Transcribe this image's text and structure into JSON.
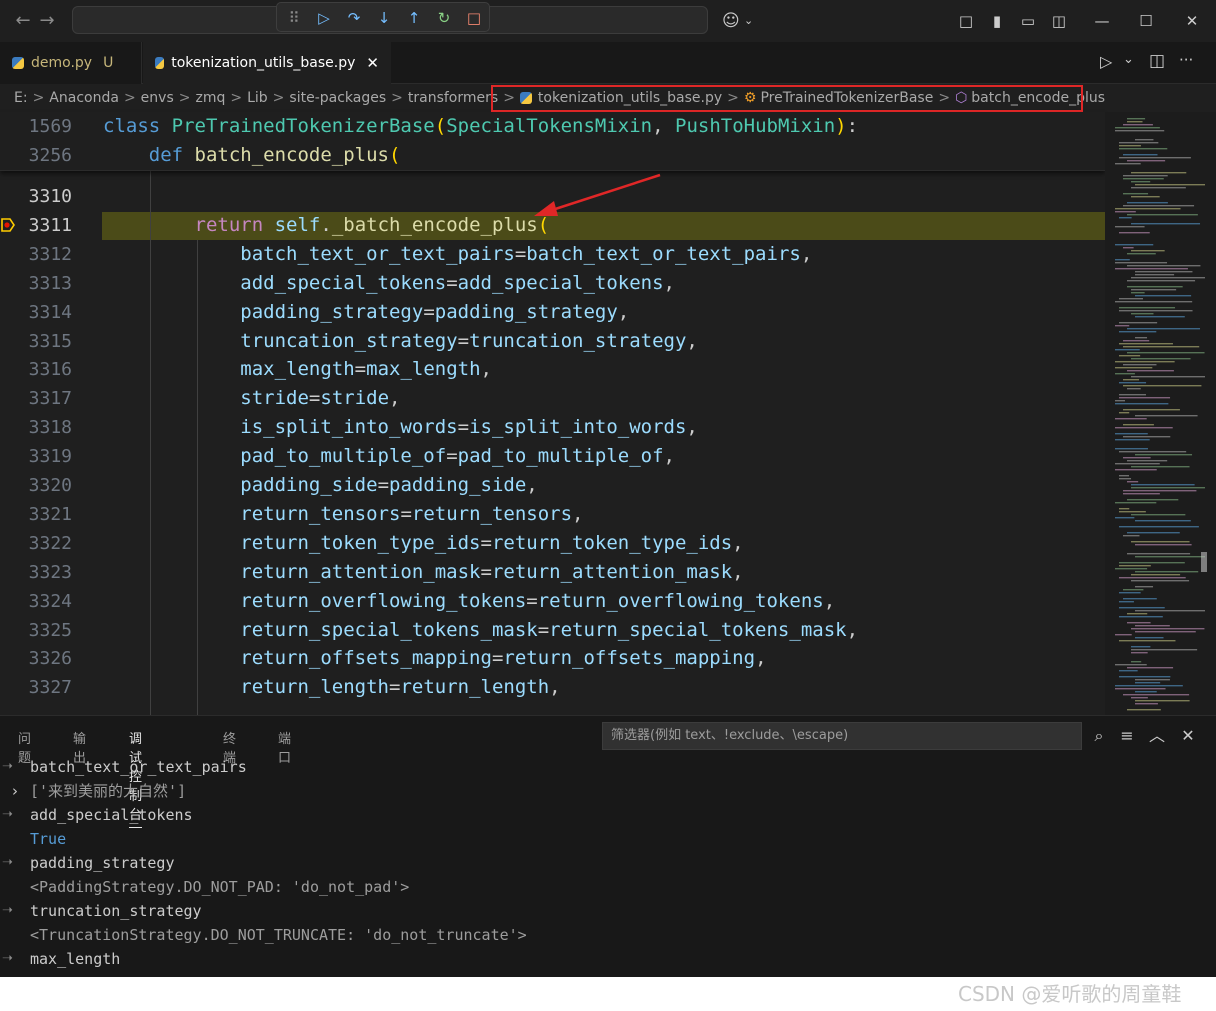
{
  "titlebar": {
    "nav_back": "←",
    "nav_forward": "→",
    "debug_buttons": [
      {
        "name": "drag-handle-icon",
        "glyph": "⠿",
        "color": "#8a8a8a"
      },
      {
        "name": "continue-icon",
        "glyph": "▷",
        "color": "#75beff"
      },
      {
        "name": "step-over-icon",
        "glyph": "↷",
        "color": "#75beff"
      },
      {
        "name": "step-into-icon",
        "glyph": "↓",
        "color": "#75beff"
      },
      {
        "name": "step-out-icon",
        "glyph": "↑",
        "color": "#75beff"
      },
      {
        "name": "restart-icon",
        "glyph": "↻",
        "color": "#89d185"
      },
      {
        "name": "stop-icon",
        "glyph": "□",
        "color": "#f48771"
      }
    ],
    "copilot_glyph": "☺",
    "window_controls": [
      "□",
      "▮",
      "▭",
      "◫",
      "—",
      "☐",
      "✕"
    ]
  },
  "tabs": [
    {
      "label": "demo.py",
      "badge": "U"
    },
    {
      "label": "tokenization_utils_base.py",
      "close": "✕"
    }
  ],
  "editor_actions": {
    "run": "▷",
    "run_menu": "⌄",
    "split": "◫",
    "more": "···"
  },
  "breadcrumb": {
    "path": [
      "E:",
      "Anaconda",
      "envs",
      "zmq",
      "Lib",
      "site-packages",
      "transformers"
    ],
    "file": "tokenization_utils_base.py",
    "class_name": "PreTrainedTokenizerBase",
    "method": "batch_encode_plus",
    "separator": ">"
  },
  "sticky": [
    {
      "ln": "1569",
      "indent": 0,
      "tokens": [
        [
          "kw",
          "class "
        ],
        [
          "cls",
          "PreTrainedTokenizerBase"
        ],
        [
          "br",
          "("
        ],
        [
          "cls",
          "SpecialTokensMixin"
        ],
        [
          "pun",
          ", "
        ],
        [
          "cls",
          "PushToHubMixin"
        ],
        [
          "br",
          ")"
        ],
        [
          "pun",
          ":"
        ]
      ]
    },
    {
      "ln": "3256",
      "indent": 4,
      "tokens": [
        [
          "kw",
          "def "
        ],
        [
          "fn",
          "batch_encode_plus"
        ],
        [
          "br",
          "("
        ]
      ]
    }
  ],
  "code_lines": [
    {
      "ln": "3310",
      "indent": 0,
      "tokens": []
    },
    {
      "ln": "3311",
      "indent": 8,
      "tokens": [
        [
          "kwc",
          "return "
        ],
        [
          "var",
          "self"
        ],
        [
          "pun",
          "."
        ],
        [
          "fn",
          "_batch_encode_plus"
        ],
        [
          "br",
          "("
        ]
      ]
    },
    {
      "ln": "3312",
      "indent": 12,
      "tokens": [
        [
          "var",
          "batch_text_or_text_pairs"
        ],
        [
          "pun",
          "="
        ],
        [
          "var",
          "batch_text_or_text_pairs"
        ],
        [
          "pun",
          ","
        ]
      ]
    },
    {
      "ln": "3313",
      "indent": 12,
      "tokens": [
        [
          "var",
          "add_special_tokens"
        ],
        [
          "pun",
          "="
        ],
        [
          "var",
          "add_special_tokens"
        ],
        [
          "pun",
          ","
        ]
      ]
    },
    {
      "ln": "3314",
      "indent": 12,
      "tokens": [
        [
          "var",
          "padding_strategy"
        ],
        [
          "pun",
          "="
        ],
        [
          "var",
          "padding_strategy"
        ],
        [
          "pun",
          ","
        ]
      ]
    },
    {
      "ln": "3315",
      "indent": 12,
      "tokens": [
        [
          "var",
          "truncation_strategy"
        ],
        [
          "pun",
          "="
        ],
        [
          "var",
          "truncation_strategy"
        ],
        [
          "pun",
          ","
        ]
      ]
    },
    {
      "ln": "3316",
      "indent": 12,
      "tokens": [
        [
          "var",
          "max_length"
        ],
        [
          "pun",
          "="
        ],
        [
          "var",
          "max_length"
        ],
        [
          "pun",
          ","
        ]
      ]
    },
    {
      "ln": "3317",
      "indent": 12,
      "tokens": [
        [
          "var",
          "stride"
        ],
        [
          "pun",
          "="
        ],
        [
          "var",
          "stride"
        ],
        [
          "pun",
          ","
        ]
      ]
    },
    {
      "ln": "3318",
      "indent": 12,
      "tokens": [
        [
          "var",
          "is_split_into_words"
        ],
        [
          "pun",
          "="
        ],
        [
          "var",
          "is_split_into_words"
        ],
        [
          "pun",
          ","
        ]
      ]
    },
    {
      "ln": "3319",
      "indent": 12,
      "tokens": [
        [
          "var",
          "pad_to_multiple_of"
        ],
        [
          "pun",
          "="
        ],
        [
          "var",
          "pad_to_multiple_of"
        ],
        [
          "pun",
          ","
        ]
      ]
    },
    {
      "ln": "3320",
      "indent": 12,
      "tokens": [
        [
          "var",
          "padding_side"
        ],
        [
          "pun",
          "="
        ],
        [
          "var",
          "padding_side"
        ],
        [
          "pun",
          ","
        ]
      ]
    },
    {
      "ln": "3321",
      "indent": 12,
      "tokens": [
        [
          "var",
          "return_tensors"
        ],
        [
          "pun",
          "="
        ],
        [
          "var",
          "return_tensors"
        ],
        [
          "pun",
          ","
        ]
      ]
    },
    {
      "ln": "3322",
      "indent": 12,
      "tokens": [
        [
          "var",
          "return_token_type_ids"
        ],
        [
          "pun",
          "="
        ],
        [
          "var",
          "return_token_type_ids"
        ],
        [
          "pun",
          ","
        ]
      ]
    },
    {
      "ln": "3323",
      "indent": 12,
      "tokens": [
        [
          "var",
          "return_attention_mask"
        ],
        [
          "pun",
          "="
        ],
        [
          "var",
          "return_attention_mask"
        ],
        [
          "pun",
          ","
        ]
      ]
    },
    {
      "ln": "3324",
      "indent": 12,
      "tokens": [
        [
          "var",
          "return_overflowing_tokens"
        ],
        [
          "pun",
          "="
        ],
        [
          "var",
          "return_overflowing_tokens"
        ],
        [
          "pun",
          ","
        ]
      ]
    },
    {
      "ln": "3325",
      "indent": 12,
      "tokens": [
        [
          "var",
          "return_special_tokens_mask"
        ],
        [
          "pun",
          "="
        ],
        [
          "var",
          "return_special_tokens_mask"
        ],
        [
          "pun",
          ","
        ]
      ]
    },
    {
      "ln": "3326",
      "indent": 12,
      "tokens": [
        [
          "var",
          "return_offsets_mapping"
        ],
        [
          "pun",
          "="
        ],
        [
          "var",
          "return_offsets_mapping"
        ],
        [
          "pun",
          ","
        ]
      ]
    },
    {
      "ln": "3327",
      "indent": 12,
      "tokens": [
        [
          "var",
          "return_length"
        ],
        [
          "pun",
          "="
        ],
        [
          "var",
          "return_length"
        ],
        [
          "pun",
          ","
        ]
      ]
    }
  ],
  "active_line": "3311",
  "panel": {
    "tabs": [
      {
        "label": "问题",
        "active": false
      },
      {
        "label": "输出",
        "active": false
      },
      {
        "label": "调试控制台",
        "active": true
      },
      {
        "label": "终端",
        "active": false
      },
      {
        "label": "端口",
        "active": false
      }
    ],
    "filter_placeholder": "筛选器(例如 text、!exclude、\\escape)",
    "icons": {
      "search": "⌕",
      "wrap": "≡",
      "collapse": "︿",
      "close": "✕"
    },
    "console": [
      {
        "kind": "in",
        "text": "batch_text_or_text_pairs"
      },
      {
        "kind": "expand",
        "text": "['来到美丽的大自然']"
      },
      {
        "kind": "in",
        "text": "add_special_tokens"
      },
      {
        "kind": "true",
        "text": "True"
      },
      {
        "kind": "in",
        "text": "padding_strategy"
      },
      {
        "kind": "out",
        "text": "<PaddingStrategy.DO_NOT_PAD: 'do_not_pad'>"
      },
      {
        "kind": "in",
        "text": "truncation_strategy"
      },
      {
        "kind": "out",
        "text": "<TruncationStrategy.DO_NOT_TRUNCATE: 'do_not_truncate'>"
      },
      {
        "kind": "in",
        "text": "max_length"
      }
    ]
  },
  "watermark": "CSDN @爱听歌的周童鞋",
  "colors": {
    "accent_red": "#e02727",
    "highlight_line": "#4b4b18",
    "breakpoint": "#ffcc00"
  }
}
